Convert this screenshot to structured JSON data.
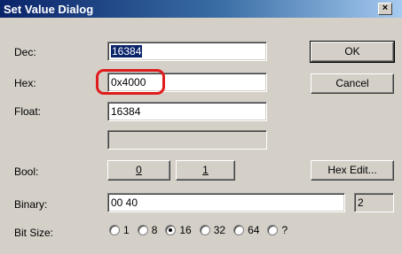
{
  "window": {
    "title": "Set Value Dialog",
    "close_glyph": "×"
  },
  "labels": {
    "dec": "Dec:",
    "hex": "Hex:",
    "float": "Float:",
    "bool": "Bool:",
    "binary": "Binary:",
    "bit_size": "Bit Size:"
  },
  "fields": {
    "dec": "16384",
    "hex": "0x4000",
    "float": "16384",
    "extra": "",
    "binary": "00 40",
    "binary_count": "2"
  },
  "buttons": {
    "ok": "OK",
    "cancel": "Cancel",
    "bool_false": "0",
    "bool_true": "1",
    "hex_edit": "Hex Edit..."
  },
  "bit_size": {
    "options": [
      "1",
      "8",
      "16",
      "32",
      "64",
      "?"
    ],
    "selected": "16"
  },
  "colors": {
    "title_bar": "#0a246a",
    "highlight": "#e01b1b",
    "selection": "#0a246a"
  }
}
